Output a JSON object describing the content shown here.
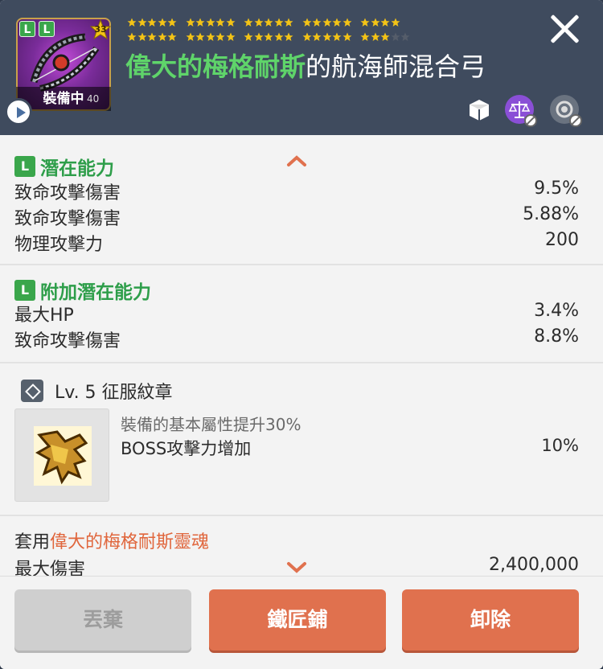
{
  "item": {
    "equipped_label": "裝備中",
    "level_text": "40",
    "star_badge": "33",
    "title_green": "偉大的梅格耐斯",
    "title_white": "的航海師混合弓",
    "stars_row1_filled": 24,
    "stars_row2_filled": 23,
    "stars_row2_total": 25
  },
  "potential": {
    "title": "潛在能力",
    "badge": "L",
    "rows": [
      {
        "k": "致命攻擊傷害",
        "v": "9.5%"
      },
      {
        "k": "致命攻擊傷害",
        "v": "5.88%"
      },
      {
        "k": "物理攻擊力",
        "v": "200"
      }
    ]
  },
  "additional": {
    "title": "附加潛在能力",
    "badge": "L",
    "rows": [
      {
        "k": "最大HP",
        "v": "3.4%"
      },
      {
        "k": "致命攻擊傷害",
        "v": "8.8%"
      }
    ]
  },
  "emblem": {
    "title": "Lv. 5 征服紋章",
    "sub": "裝備的基本屬性提升30%",
    "stat_k": "BOSS攻擊力增加",
    "stat_v": "10%"
  },
  "set": {
    "prefix": "套用",
    "name": "偉大的梅格耐斯靈魂",
    "row_k": "最大傷害",
    "row_v": "2,400,000"
  },
  "buttons": {
    "discard": "丟棄",
    "smith": "鐵匠鋪",
    "unequip": "卸除"
  },
  "colors": {
    "header_bg": "#3f4b5e",
    "accent_green": "#3aa64b",
    "title_green": "#5fd46a",
    "orange": "#e0714e",
    "star_gold": "#f3c316"
  }
}
